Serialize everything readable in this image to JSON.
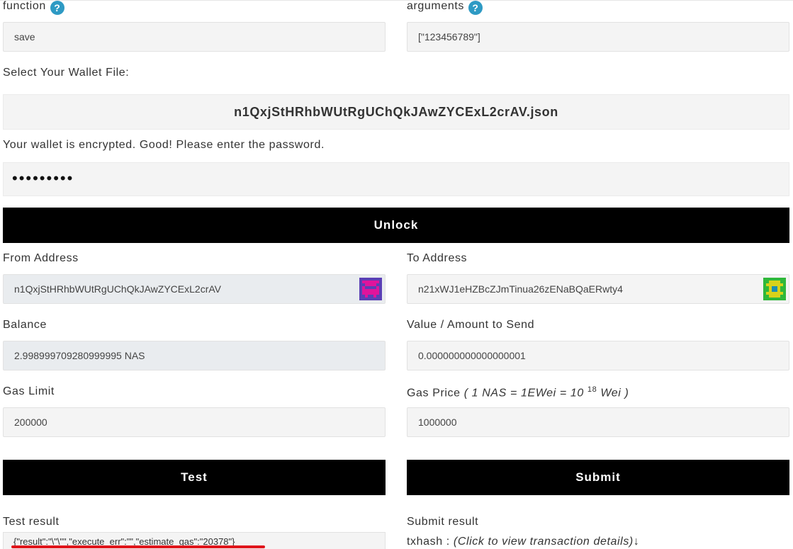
{
  "contract": {
    "function_label": "function",
    "function_value": "save",
    "arguments_label": "arguments",
    "arguments_value": "[\"123456789\"]",
    "help_glyph": "?"
  },
  "wallet": {
    "select_label": "Select Your Wallet File:",
    "file_name": "n1QxjStHRhbWUtRgUChQkJAwZYCExL2crAV.json",
    "encrypted_message": "Your wallet is encrypted. Good! Please enter the password.",
    "password_mask": "•••••••••",
    "unlock_label": "Unlock"
  },
  "transaction": {
    "from_label": "From Address",
    "from_value": "n1QxjStHRhbWUtRgUChQkJAwZYCExL2crAV",
    "to_label": "To Address",
    "to_value": "n21xWJ1eHZBcZJmTinua26zENaBQaERwty4",
    "balance_label": "Balance",
    "balance_value": "2.998999709280999995 NAS",
    "value_label": "Value / Amount to Send",
    "value_value": "0.000000000000000001",
    "gas_limit_label": "Gas Limit",
    "gas_limit_value": "200000",
    "gas_price_label": "Gas Price",
    "gas_price_note_prefix": "( 1 NAS = 1EWei = 10",
    "gas_price_note_exp": "18",
    "gas_price_note_suffix": "Wei )",
    "gas_price_value": "1000000",
    "test_label": "Test",
    "submit_label": "Submit"
  },
  "results": {
    "test_result_label": "Test result",
    "test_result_value": "{\"result\":\"\\\"\\\"\",\"execute_err\":\"\",\"estimate_gas\":\"20378\"}",
    "submit_result_label": "Submit result",
    "txhash_label": "txhash :",
    "txhash_hint": "(Click to view transaction details)↓"
  },
  "colors": {
    "button_bg": "#000000",
    "help_icon": "#2e9ac4",
    "underline_annotation": "#e0141a"
  },
  "icons": {
    "help": "question-circle-icon",
    "from_identicon": "identicon-magenta",
    "to_identicon": "identicon-green"
  }
}
